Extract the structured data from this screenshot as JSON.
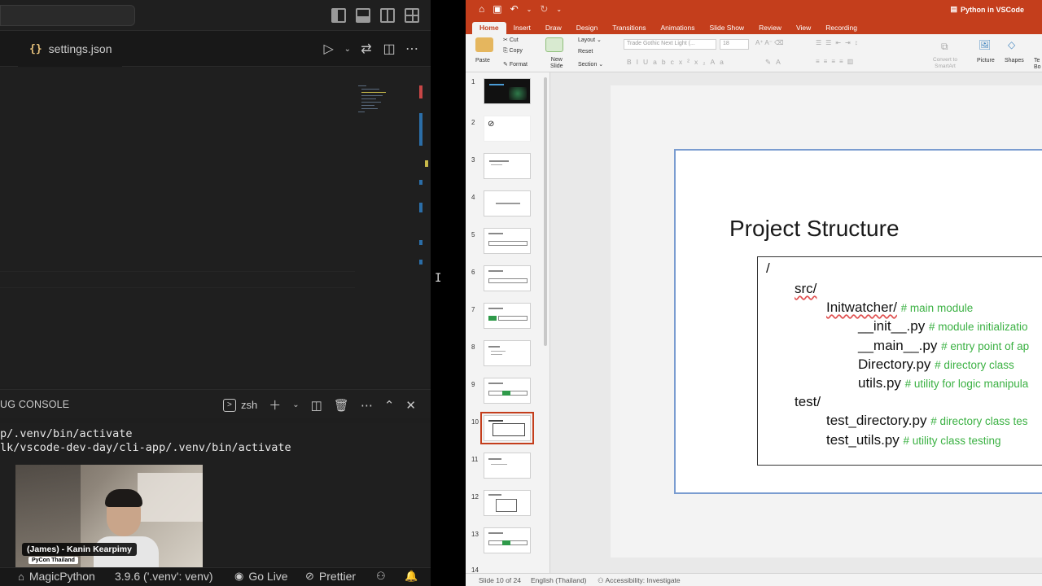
{
  "vscode": {
    "tab": {
      "icon": "{}",
      "label": "settings.json"
    },
    "panel_title": "UG CONSOLE",
    "terminal_name": "zsh",
    "terminal_lines": [
      "p/.venv/bin/activate",
      "lk/vscode-dev-day/cli-app/.venv/bin/activate"
    ],
    "webcam": {
      "name": "(James) - Kanin Kearpimy",
      "org": "PyCon Thailand"
    },
    "status": {
      "extension": "MagicPython",
      "interpreter": "3.9.6 ('.venv': venv)",
      "go_live": "Go Live",
      "prettier": "Prettier"
    }
  },
  "ppt": {
    "doc_title": "Python in VSCode",
    "tabs": [
      "Home",
      "Insert",
      "Draw",
      "Design",
      "Transitions",
      "Animations",
      "Slide Show",
      "Review",
      "View",
      "Recording"
    ],
    "active_tab": "Home",
    "ribbon": {
      "paste": "Paste",
      "cut": "Cut",
      "copy": "Copy",
      "format": "Format",
      "new_slide": "New\nSlide",
      "layout": "Layout",
      "reset": "Reset",
      "section": "Section",
      "font_name": "Trade Gothic Next Light (...",
      "font_size": "18",
      "convert": "Convert to SmartArt",
      "picture": "Picture",
      "shapes": "Shapes",
      "text_box": "Text Box"
    },
    "slide_numbers": [
      "1",
      "2",
      "3",
      "4",
      "5",
      "6",
      "7",
      "8",
      "9",
      "10",
      "11",
      "12",
      "13",
      "14"
    ],
    "active_slide": "10",
    "slide": {
      "title": "Project Structure",
      "tree": [
        {
          "text": "/",
          "comment": ""
        },
        {
          "text": "src/",
          "comment": ""
        },
        {
          "text": "Initwatcher/",
          "comment": "# main module"
        },
        {
          "text": "__init__.py",
          "comment": "# module initializatio"
        },
        {
          "text": "__main__.py",
          "comment": "# entry point of ap"
        },
        {
          "text": "Directory.py",
          "comment": "# directory class"
        },
        {
          "text": "utils.py",
          "comment": "# utility for logic manipula"
        },
        {
          "text": "test/",
          "comment": ""
        },
        {
          "text": "test_directory.py",
          "comment": "# directory class tes"
        },
        {
          "text": "test_utils.py",
          "comment": "# utility class testing"
        }
      ]
    },
    "status": {
      "slide_of": "Slide 10 of 24",
      "language": "English (Thailand)",
      "accessibility": "Accessibility: Investigate"
    }
  },
  "colors": {
    "ppt_accent": "#c43e1c",
    "vscode_bg": "#1e1e1e",
    "comment_green": "#3bb143"
  }
}
